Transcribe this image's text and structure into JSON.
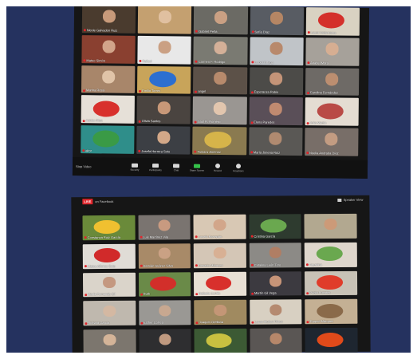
{
  "meeting_top": {
    "participants": [
      {
        "name": "Nicole Galvadon Ruiz",
        "bg": "#4a3b2e",
        "face": "#c89a7a",
        "muted": true
      },
      {
        "name": "",
        "bg": "#c4a070",
        "face": "#e0c0a0",
        "muted": false
      },
      {
        "name": "Gabriel Peña",
        "bg": "#6b6a64",
        "face": "#caa083",
        "muted": true
      },
      {
        "name": "Sofía Díaz",
        "bg": "#585c63",
        "face": "#b58664",
        "muted": true
      },
      {
        "name": "Laura Valderrama",
        "bg": "#d9d2c2",
        "drawing": "#d4302b",
        "muted": true
      },
      {
        "name": "Mateo Simón",
        "bg": "#8a4030",
        "face": "#d2a48a",
        "muted": true
      },
      {
        "name": "Rafael",
        "bg": "#e8e8e8",
        "face": "#caa083",
        "muted": true
      },
      {
        "name": "Carmen F. Rodrigo",
        "bg": "#7a7a72",
        "face": "#d4b098",
        "muted": true
      },
      {
        "name": "Isabel Ortega",
        "bg": "#c0c4c8",
        "face": "#b8896c",
        "muted": true
      },
      {
        "name": "Anabel Mora",
        "bg": "#a6a19a",
        "face": "#d6ae92",
        "muted": true
      },
      {
        "name": "Marina Rossi",
        "bg": "#a8866a",
        "face": "#e0c4a8",
        "muted": true
      },
      {
        "name": "Emilio Torres",
        "bg": "#c8a45a",
        "drawing": "#2c6fd0",
        "muted": true
      },
      {
        "name": "angel",
        "bg": "#5c5148",
        "face": "#b78a6c",
        "muted": true
      },
      {
        "name": "Esperanza Rubio",
        "bg": "#4c4b48",
        "face": "#c49478",
        "muted": true
      },
      {
        "name": "Carolina Fernández",
        "bg": "#6e6a66",
        "face": "#bc8e70",
        "muted": true
      },
      {
        "name": "Adrián Ríos",
        "bg": "#e6e0d8",
        "drawing": "#d8302c",
        "muted": true
      },
      {
        "name": "Olivia Santos",
        "bg": "#4a4440",
        "face": "#c89878",
        "muted": true
      },
      {
        "name": "Saúl R. Romero",
        "bg": "#9a9692",
        "face": "#e2c6ae",
        "muted": true
      },
      {
        "name": "Elena Paredes",
        "bg": "#5a4f58",
        "face": "#c08a70",
        "muted": true
      },
      {
        "name": "Julia Martín",
        "bg": "#e4dcd2",
        "drawing": "#b94a46",
        "muted": true
      },
      {
        "name": "aitor",
        "bg": "#2f8e8a",
        "drawing": "#3a9a46",
        "muted": true
      },
      {
        "name": "Josefa Herrera Soto",
        "bg": "#3c3f44",
        "face": "#d3a888",
        "muted": true
      },
      {
        "name": "Tamara Jiménez",
        "bg": "#8a7a50",
        "drawing": "#d6b44a",
        "muted": true
      },
      {
        "name": "María Jimena Ruiz",
        "bg": "#5a5855",
        "face": "#b08a70",
        "muted": true
      },
      {
        "name": "Noelia Andrada Díez",
        "bg": "#786e68",
        "face": "#c39c82",
        "muted": true
      }
    ],
    "toolbar": {
      "left_label": "Stop Video",
      "buttons": [
        {
          "label": "Security",
          "icon": "shield-icon"
        },
        {
          "label": "Participants",
          "icon": "participants-icon"
        },
        {
          "label": "Chat",
          "icon": "chat-icon"
        },
        {
          "label": "Share Screen",
          "icon": "share-screen-icon"
        },
        {
          "label": "Record",
          "icon": "record-icon"
        },
        {
          "label": "Reactions",
          "icon": "reactions-icon"
        }
      ]
    }
  },
  "meeting_bottom": {
    "header": {
      "left_text": "",
      "live_badge": "LIVE",
      "on_text": "on Facebook",
      "right_text": "Speaker View"
    },
    "participants": [
      {
        "name": "Constanza Ruiz García",
        "bg": "#6a8a3a",
        "drawing": "#f0c030",
        "muted": true
      },
      {
        "name": "Luis Martínez Vila",
        "bg": "#7a7470",
        "face": "#c89a80",
        "muted": true
      },
      {
        "name": "Josefa Barragán",
        "bg": "#d8c8b4",
        "face": "#d2a68a",
        "muted": true
      },
      {
        "name": "Cristina García",
        "bg": "#2e3b2f",
        "drawing": "#6aa84f",
        "muted": true
      },
      {
        "name": "",
        "bg": "#b2a890",
        "face": "#cc9a78",
        "muted": false
      },
      {
        "name": "Mateo Alfonso Soto",
        "bg": "#e0dcd6",
        "drawing": "#d12a2a",
        "muted": true
      },
      {
        "name": "Damián Suárez Silva",
        "bg": "#a88a68",
        "face": "#caa184",
        "muted": true
      },
      {
        "name": "Rosario Márquez",
        "bg": "#d4c6b6",
        "face": "#d8b094",
        "muted": true
      },
      {
        "name": "Catalina León Toro",
        "bg": "#8c8a86",
        "face": "#b07e64",
        "muted": true
      },
      {
        "name": "Agustina",
        "bg": "#ded6cc",
        "drawing": "#6aa84f",
        "muted": true
      },
      {
        "name": "María Fernanda Gil",
        "bg": "#dad4ca",
        "face": "#c49880",
        "muted": true
      },
      {
        "name": "Ruth",
        "bg": "#6a8a48",
        "drawing": "#d22f2a",
        "muted": true
      },
      {
        "name": "Rafaela Cortés",
        "bg": "#e8e0d4",
        "drawing": "#d8302c",
        "muted": true
      },
      {
        "name": "Martín Gil Vega",
        "bg": "#3c3a40",
        "face": "#c69478",
        "muted": true
      },
      {
        "name": "Pablo Fuentes",
        "bg": "#c8c2b6",
        "drawing": "#e03c2a",
        "muted": true
      },
      {
        "name": "Richard García",
        "bg": "#bfb8ae",
        "face": "#d4b8a2",
        "muted": true
      },
      {
        "name": "Esther Correa",
        "bg": "#9a9894",
        "face": "#c8a890",
        "muted": true
      },
      {
        "name": "Joaquín Orellana",
        "bg": "#a08a60",
        "face": "#c49676",
        "muted": true
      },
      {
        "name": "Lucas Muñoz Pérez",
        "bg": "#d8d0c2",
        "face": "#b58a70",
        "muted": true
      },
      {
        "name": "Raquel Márquez",
        "bg": "#c4b094",
        "drawing": "#8a6a4a",
        "muted": true
      },
      {
        "name": "",
        "bg": "#7c766e",
        "face": "#d4b498",
        "muted": false
      },
      {
        "name": "",
        "bg": "#2e2e30",
        "face": "#c09a80",
        "muted": false
      },
      {
        "name": "",
        "bg": "#3c5a34",
        "drawing": "#c8c040",
        "muted": false
      },
      {
        "name": "",
        "bg": "#5a5654",
        "face": "#b6876a",
        "muted": false
      },
      {
        "name": "",
        "bg": "#1e2630",
        "drawing": "#e04a1a",
        "muted": false
      }
    ]
  }
}
